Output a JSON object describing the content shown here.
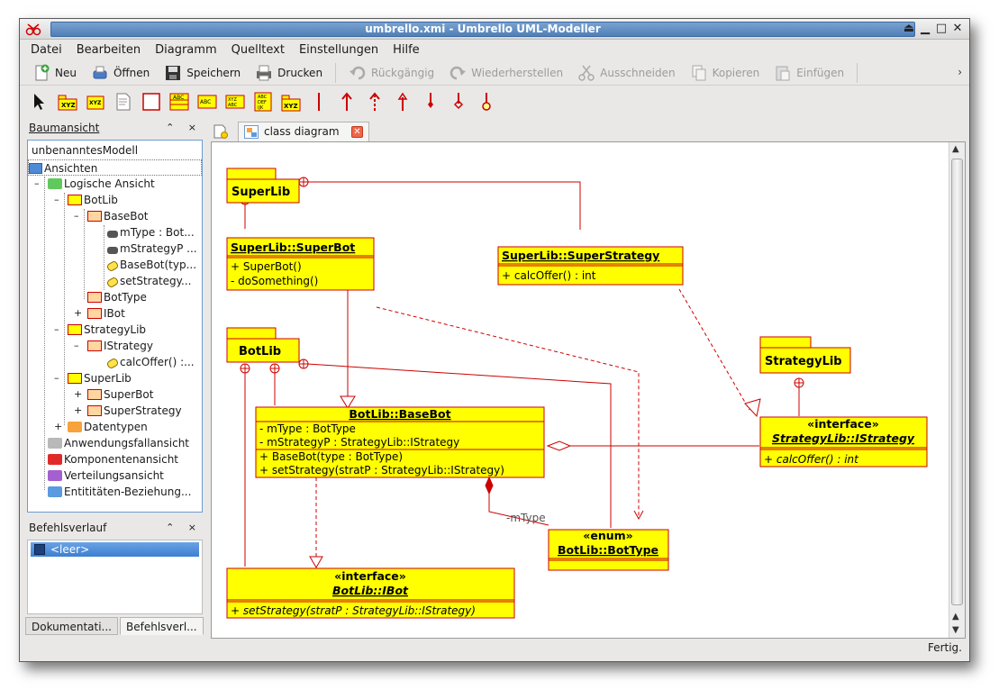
{
  "window": {
    "title": "umbrello.xmi - Umbrello UML-Modeller",
    "controls": [
      "⏏",
      "▁",
      "□",
      "✕"
    ]
  },
  "menu": [
    "Datei",
    "Bearbeiten",
    "Diagramm",
    "Quelltext",
    "Einstellungen",
    "Hilfe"
  ],
  "toolbar": {
    "new": "Neu",
    "open": "Öffnen",
    "save": "Speichern",
    "print": "Drucken",
    "undo": "Rückgängig",
    "redo": "Wiederherstellen",
    "cut": "Ausschneiden",
    "copy": "Kopieren",
    "paste": "Einfügen"
  },
  "tree_panel": {
    "title": "Baumansicht",
    "controls": "⌃ ×",
    "root": "unbenanntesModell",
    "items": [
      {
        "label": "Ansichten",
        "icon": "folder-view-icon"
      },
      {
        "label": "Logische Ansicht",
        "icon": "folder-green-icon"
      },
      {
        "label": "BotLib",
        "icon": "package-icon"
      },
      {
        "label": "BaseBot",
        "icon": "class-icon"
      },
      {
        "label": "mType : Bot...",
        "icon": "attribute-icon"
      },
      {
        "label": "mStrategyP ...",
        "icon": "attribute-icon"
      },
      {
        "label": "BaseBot(typ...",
        "icon": "operation-icon"
      },
      {
        "label": "setStrategy...",
        "icon": "operation-icon"
      },
      {
        "label": "BotType",
        "icon": "class-icon"
      },
      {
        "label": "IBot",
        "icon": "interface-icon"
      },
      {
        "label": "StrategyLib",
        "icon": "package-icon"
      },
      {
        "label": "IStrategy",
        "icon": "interface-icon"
      },
      {
        "label": "calcOffer() :...",
        "icon": "operation-icon"
      },
      {
        "label": "SuperLib",
        "icon": "package-icon"
      },
      {
        "label": "SuperBot",
        "icon": "class-icon"
      },
      {
        "label": "SuperStrategy",
        "icon": "class-icon"
      },
      {
        "label": "Datentypen",
        "icon": "folder-orange-icon"
      },
      {
        "label": "Anwendungsfallansicht",
        "icon": "folder-gray-icon"
      },
      {
        "label": "Komponentenansicht",
        "icon": "folder-red-icon"
      },
      {
        "label": "Verteilungsansicht",
        "icon": "folder-purple-icon"
      },
      {
        "label": "Entititäten-Beziehung...",
        "icon": "folder-blue-icon"
      }
    ]
  },
  "history_panel": {
    "title": "Befehlsverlauf",
    "controls": "⌃ ×",
    "item": "<leer>"
  },
  "bottom_tabs": [
    "Dokumentati...",
    "Befehlsverl..."
  ],
  "diagram_tab": "class diagram",
  "diagram": {
    "packages": {
      "superlib": "SuperLib",
      "botlib": "BotLib",
      "strategylib": "StrategyLib"
    },
    "superbot": {
      "title": "SuperLib::SuperBot",
      "ops": [
        "+ SuperBot()",
        "- doSomething()"
      ]
    },
    "superstrategy": {
      "title": "SuperLib::SuperStrategy",
      "ops": [
        "+ calcOffer() : int"
      ]
    },
    "basebot": {
      "title": "BotLib::BaseBot",
      "attrs": [
        "- mType : BotType",
        "- mStrategyP : StrategyLib::IStrategy"
      ],
      "ops": [
        "+ BaseBot(type : BotType)",
        "+ setStrategy(stratP : StrategyLib::IStrategy)"
      ]
    },
    "istrategy": {
      "stereotype": "«interface»",
      "title": "StrategyLib::IStrategy",
      "ops": [
        "+ calcOffer() : int"
      ]
    },
    "bottype": {
      "stereotype": "«enum»",
      "title": "BotLib::BotType"
    },
    "ibot": {
      "stereotype": "«interface»",
      "title": "BotLib::IBot",
      "ops": [
        "+ setStrategy(stratP : StrategyLib::IStrategy)"
      ]
    },
    "role_label": "-mType"
  },
  "status": "Fertig.",
  "colors": {
    "uml_fill": "#ffff00",
    "uml_line": "#c00000",
    "selection": "#3d7fd1"
  }
}
